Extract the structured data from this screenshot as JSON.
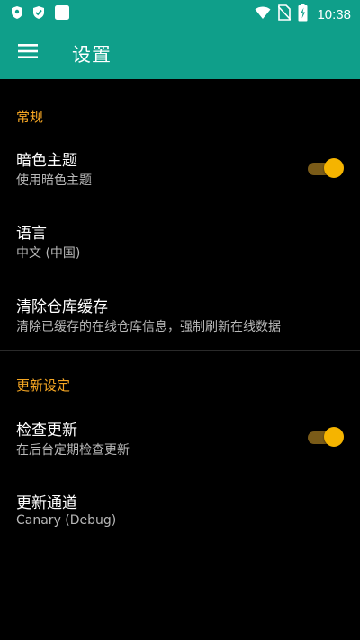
{
  "status_bar": {
    "time": "10:38",
    "left_icons": [
      "shield-icon",
      "security-badge-icon",
      "notification-square-icon"
    ],
    "right_icons": [
      "wifi-icon",
      "no-sim-icon",
      "battery-charging-icon"
    ]
  },
  "toolbar": {
    "title": "设置",
    "menu_icon": "hamburger-menu-icon"
  },
  "colors": {
    "toolbar": "#0f9f8a",
    "accent": "#f5a623",
    "background": "#000000",
    "summary_text": "#b8b8b8"
  },
  "sections": {
    "general": {
      "header": "常规",
      "dark_theme": {
        "title": "暗色主题",
        "summary": "使用暗色主题",
        "enabled": true
      },
      "language": {
        "title": "语言",
        "summary": "中文 (中国)"
      },
      "clear_cache": {
        "title": "清除仓库缓存",
        "summary": "清除已缓存的在线仓库信息，强制刷新在线数据"
      }
    },
    "update": {
      "header": "更新设定",
      "check_update": {
        "title": "检查更新",
        "summary": "在后台定期检查更新",
        "enabled": true
      },
      "update_channel": {
        "title": "更新通道",
        "summary": "Canary (Debug)"
      }
    }
  }
}
